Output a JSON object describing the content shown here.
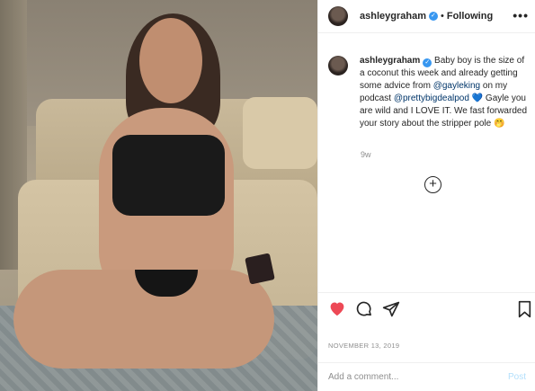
{
  "post": {
    "username": "ashleygraham",
    "follow_separator": "•",
    "follow_state": "Following",
    "more_label": "•••",
    "caption": {
      "username": "ashleygraham",
      "part1": " Baby boy is the size of a coconut this week and already getting some advice from ",
      "mention1": "@gayleking",
      "part2": " on my podcast ",
      "mention2": "@prettybigdealpod",
      "emoji1": "💙",
      "part3": " Gayle you are wild and I LOVE IT. We fast forwarded your story about the stripper pole ",
      "emoji2": "🤭"
    },
    "time_ago": "9w",
    "load_more_label": "+",
    "date": "NOVEMBER 13, 2019",
    "comment_placeholder": "Add a comment...",
    "post_label": "Post",
    "like_color": "#ed4956"
  },
  "icons": {
    "verified": "verified-badge-icon",
    "like": "heart-icon",
    "comment": "comment-icon",
    "share": "paper-plane-icon",
    "save": "bookmark-icon"
  }
}
